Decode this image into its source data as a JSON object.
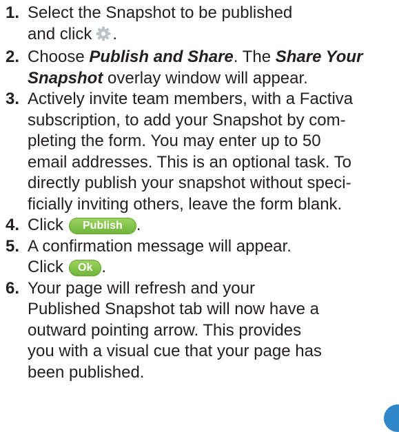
{
  "steps": [
    {
      "number": "1.",
      "line1": "Select the Snapshot to be published",
      "line2": "and click",
      "end": "."
    },
    {
      "number": "2.",
      "t1": "Choose ",
      "b1": "Publish and Share",
      "t2": ". The ",
      "b2": "Share Your Snapshot",
      "t3": " overlay window will appear."
    },
    {
      "number": "3.",
      "lines": [
        "Actively invite team members, with a Factiva",
        "subscription, to add your Snapshot by com-",
        "pleting the form. You may enter up to 50",
        "email addresses. This is an optional task. To",
        "directly publish your snapshot without speci-",
        "ficially inviting others, leave the form blank."
      ]
    },
    {
      "number": "4.",
      "text": "Click",
      "button": "Publish",
      "end": "."
    },
    {
      "number": "5.",
      "line1": "A confirmation message will appear.",
      "text2": "Click",
      "button": "Ok",
      "end": "."
    },
    {
      "number": "6.",
      "lines": [
        "Your page will refresh and your",
        "Published Snapshot tab will now have a",
        "outward pointing arrow.  This provides",
        "you with a visual cue that your page has",
        "been published."
      ]
    }
  ],
  "icons": {
    "settings": "gear-icon"
  },
  "colors": {
    "button_green": "#7cc043",
    "badge_blue": "#2f86c8",
    "text": "#231f20"
  }
}
